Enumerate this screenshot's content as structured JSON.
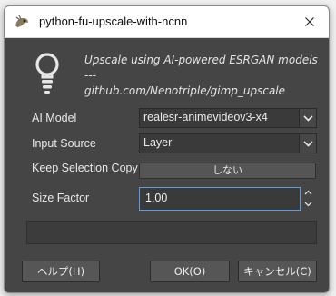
{
  "window": {
    "title": "python-fu-upscale-with-ncnn"
  },
  "info": {
    "line1": "Upscale using AI-powered ESRGAN models",
    "line2": "---",
    "line3": "github.com/Nenotriple/gimp_upscale"
  },
  "form": {
    "ai_model": {
      "label": "AI Model",
      "value": "realesr-animevideov3-x4"
    },
    "input_source": {
      "label": "Input Source",
      "value": "Layer"
    },
    "keep_selection_copy": {
      "label": "Keep Selection Copy",
      "value": "しない"
    },
    "size_factor": {
      "label": "Size Factor",
      "value": "1.00"
    }
  },
  "buttons": {
    "help": "ヘルプ(H)",
    "ok": "OK(O)",
    "cancel": "キャンセル(C)"
  },
  "colors": {
    "dialog_bg": "#454545",
    "focus_border": "#5a9de0"
  },
  "icons": [
    "gimp-app-icon",
    "close-icon",
    "lightbulb-icon",
    "chevron-down-icon",
    "spin-up-icon",
    "spin-down-icon"
  ]
}
